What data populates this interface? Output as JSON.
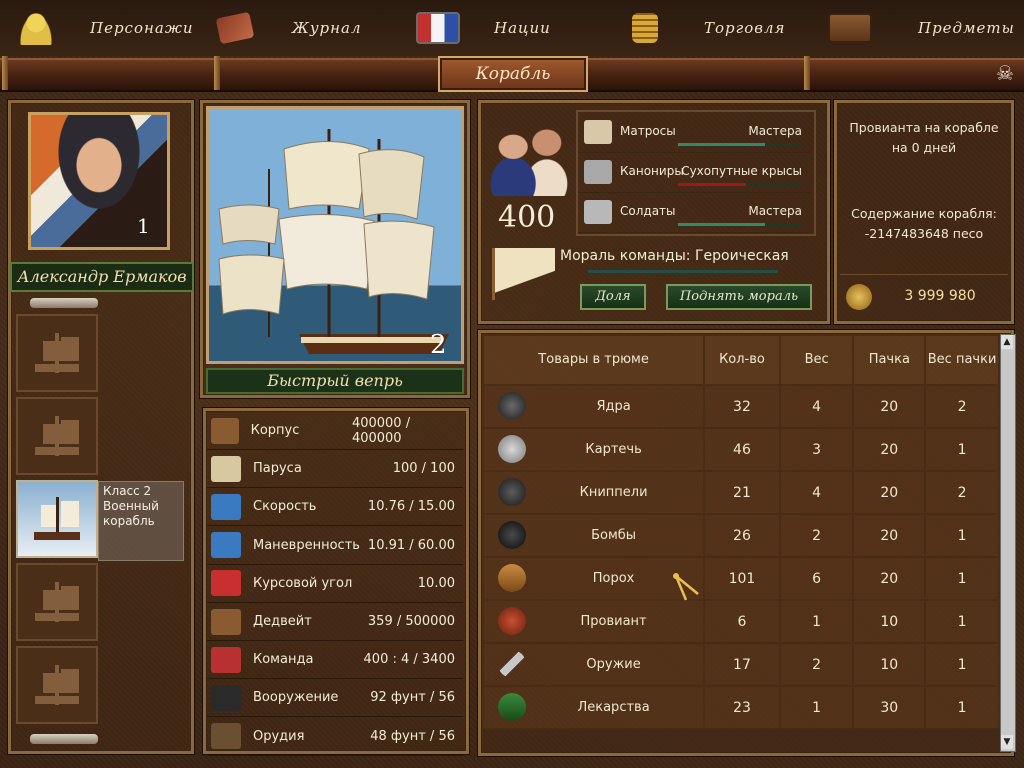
{
  "menu": {
    "characters": "Персонажи",
    "journal": "Журнал",
    "nations": "Нации",
    "trade": "Торговля",
    "items": "Предметы"
  },
  "screen_title": "Корабль",
  "character": {
    "name": "Александр Ермаков",
    "number": "1"
  },
  "selected_ship": {
    "name": "Быстрый вепрь",
    "number": "2",
    "class_info": "Класс 2 Военный корабль"
  },
  "ship_stats": [
    {
      "icon": "hull-icon",
      "label": "Корпус",
      "value": "400000 / 400000"
    },
    {
      "icon": "sails-icon",
      "label": "Паруса",
      "value": "100 / 100"
    },
    {
      "icon": "speed-icon",
      "label": "Скорость",
      "value": "10.76 / 15.00"
    },
    {
      "icon": "maneuver-icon",
      "label": "Маневренность",
      "value": "10.91 / 60.00"
    },
    {
      "icon": "course-angle-icon",
      "label": "Курсовой угол",
      "value": "10.00"
    },
    {
      "icon": "deadweight-icon",
      "label": "Дедвейт",
      "value": "359 / 500000"
    },
    {
      "icon": "crew-icon",
      "label": "Команда",
      "value": "400 : 4 / 3400"
    },
    {
      "icon": "armament-icon",
      "label": "Вооружение",
      "value": "92 фунт / 56"
    },
    {
      "icon": "cannons-icon",
      "label": "Орудия",
      "value": "48 фунт / 56"
    }
  ],
  "crew": {
    "count": "400",
    "rows": [
      {
        "label": "Матросы",
        "level": "Мастера",
        "bar_color": "#2f8a6a",
        "bar_fraction": 0.7
      },
      {
        "label": "Канониры",
        "level": "Сухопутные крысы",
        "bar_color": "#a01818",
        "bar_fraction": 0.55
      },
      {
        "label": "Солдаты",
        "level": "Мастера",
        "bar_color": "#2f8a6a",
        "bar_fraction": 0.7
      }
    ],
    "morale": "Мораль команды: Героическая",
    "share_button": "Доля",
    "raise_morale_button": "Поднять мораль"
  },
  "provisions": {
    "days_text": "Провианта на корабле на 0 дней",
    "upkeep_text": "Содержание корабля: -2147483648 песо",
    "money": "3 999 980"
  },
  "cargo": {
    "headers": [
      "Товары в трюме",
      "Кол-во",
      "Вес",
      "Пачка",
      "Вес пачки"
    ],
    "rows": [
      {
        "icon": "cannonballs-icon",
        "name": "Ядра",
        "qty": "32",
        "weight": "4",
        "pack": "20",
        "pack_weight": "2"
      },
      {
        "icon": "grapeshot-icon",
        "name": "Картечь",
        "qty": "46",
        "weight": "3",
        "pack": "20",
        "pack_weight": "1"
      },
      {
        "icon": "chainshot-icon",
        "name": "Книппели",
        "qty": "21",
        "weight": "4",
        "pack": "20",
        "pack_weight": "2"
      },
      {
        "icon": "bombs-icon",
        "name": "Бомбы",
        "qty": "26",
        "weight": "2",
        "pack": "20",
        "pack_weight": "1"
      },
      {
        "icon": "powder-icon",
        "name": "Порох",
        "qty": "101",
        "weight": "6",
        "pack": "20",
        "pack_weight": "1"
      },
      {
        "icon": "provisions-icon",
        "name": "Провиант",
        "qty": "6",
        "weight": "1",
        "pack": "10",
        "pack_weight": "1"
      },
      {
        "icon": "weapons-icon",
        "name": "Оружие",
        "qty": "17",
        "weight": "2",
        "pack": "10",
        "pack_weight": "1"
      },
      {
        "icon": "medicine-icon",
        "name": "Лекарства",
        "qty": "23",
        "weight": "1",
        "pack": "30",
        "pack_weight": "1"
      }
    ]
  }
}
